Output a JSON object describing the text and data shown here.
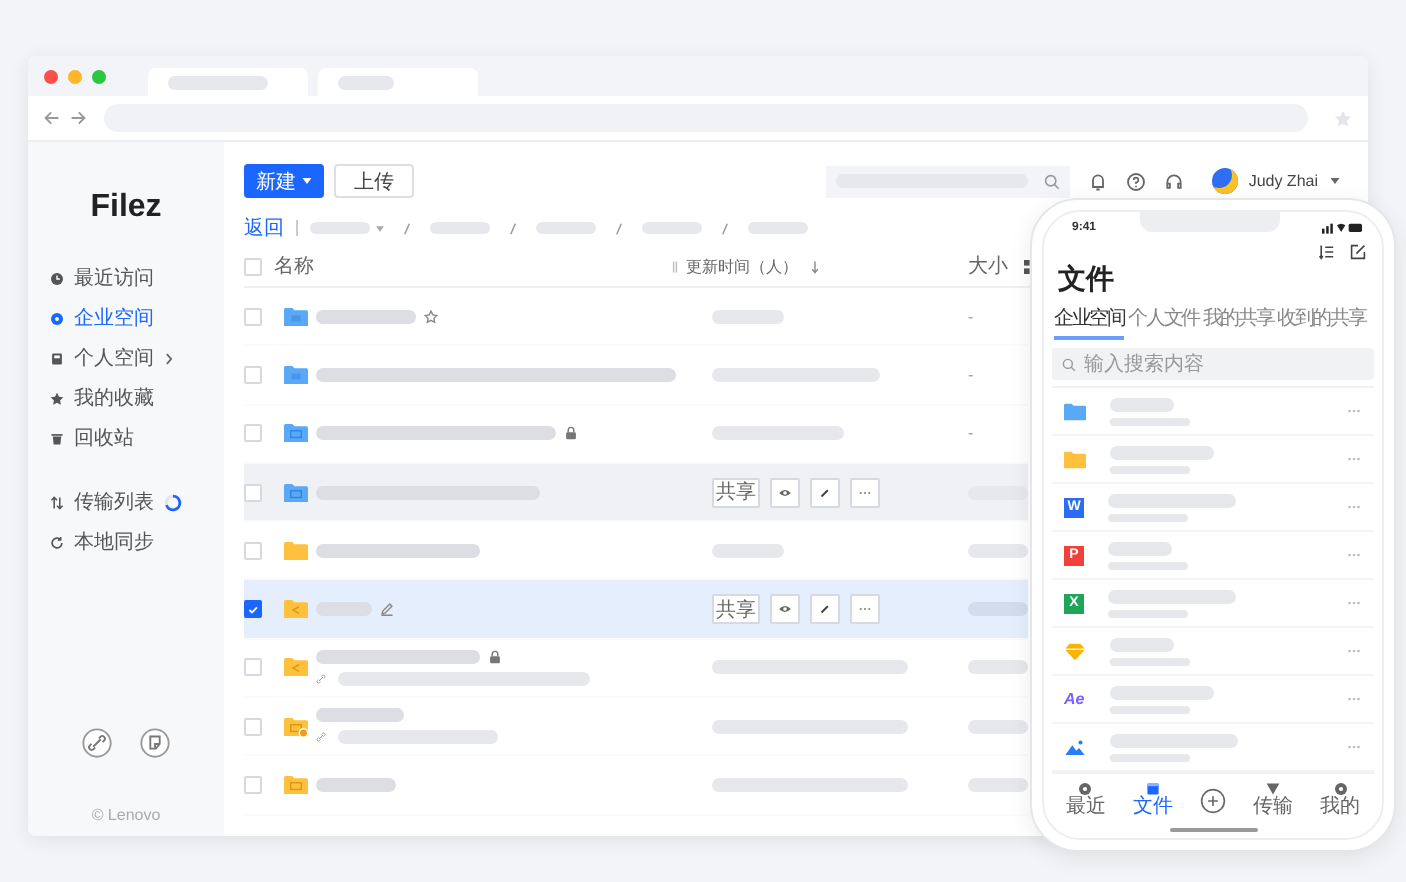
{
  "sidebar": {
    "logo": "Filez",
    "items": [
      {
        "label": "最近访问",
        "selected": false
      },
      {
        "label": "企业空间",
        "selected": true
      },
      {
        "label": "个人空间",
        "selected": false,
        "expandable": true
      },
      {
        "label": "我的收藏",
        "selected": false
      },
      {
        "label": "回收站",
        "selected": false
      }
    ],
    "tools": [
      {
        "label": "传输列表",
        "in_progress": true
      },
      {
        "label": "本地同步",
        "in_progress": false
      }
    ],
    "copyright": "© Lenovo"
  },
  "toolbar": {
    "new_button": "新建",
    "upload_button": "上传"
  },
  "user": {
    "name": "Judy Zhai"
  },
  "breadcrumb": {
    "back": "返回"
  },
  "table": {
    "select_all": false,
    "columns": [
      "名称",
      "更新时间（人）",
      "大小"
    ],
    "rows": [
      {
        "kind": "blue-user",
        "starred": true,
        "selected": false,
        "hovered": false,
        "size": "-"
      },
      {
        "kind": "blue-user",
        "selected": false,
        "hovered": false,
        "size": "-"
      },
      {
        "kind": "blue-screen",
        "locked": true,
        "selected": false,
        "hovered": false,
        "size": "-"
      },
      {
        "kind": "blue-screen",
        "selected": false,
        "hovered": true,
        "share_label": "共享"
      },
      {
        "kind": "yellow",
        "selected": false,
        "hovered": false
      },
      {
        "kind": "yellow-share",
        "editable": true,
        "selected": true,
        "hovered": false,
        "share_label": "共享"
      },
      {
        "kind": "yellow-share",
        "locked": true,
        "linked": true,
        "selected": false,
        "hovered": false
      },
      {
        "kind": "yellow-badge",
        "linked": true,
        "selected": false,
        "hovered": false
      },
      {
        "kind": "yellow-screen",
        "selected": false,
        "hovered": false
      }
    ]
  },
  "phone": {
    "time": "9:41",
    "title": "文件",
    "tabs": [
      {
        "label": "企业空间",
        "selected": true
      },
      {
        "label": "个人文件",
        "selected": false
      },
      {
        "label": "我的共享",
        "selected": false
      },
      {
        "label": "收到的共享",
        "selected": false
      }
    ],
    "search": {
      "placeholder": "输入搜索内容"
    },
    "files": [
      {
        "kind": "folder-blue"
      },
      {
        "kind": "folder-yellow"
      },
      {
        "kind": "word",
        "glyph": "W"
      },
      {
        "kind": "ppt",
        "glyph": "P"
      },
      {
        "kind": "excel",
        "glyph": "X"
      },
      {
        "kind": "sketch"
      },
      {
        "kind": "ae",
        "glyph": "Ae"
      },
      {
        "kind": "image"
      }
    ],
    "nav": [
      {
        "label": "最近",
        "selected": false
      },
      {
        "label": "文件",
        "selected": true
      },
      {
        "selected": false
      },
      {
        "label": "传输",
        "selected": false
      },
      {
        "label": "我的",
        "selected": false
      }
    ]
  }
}
